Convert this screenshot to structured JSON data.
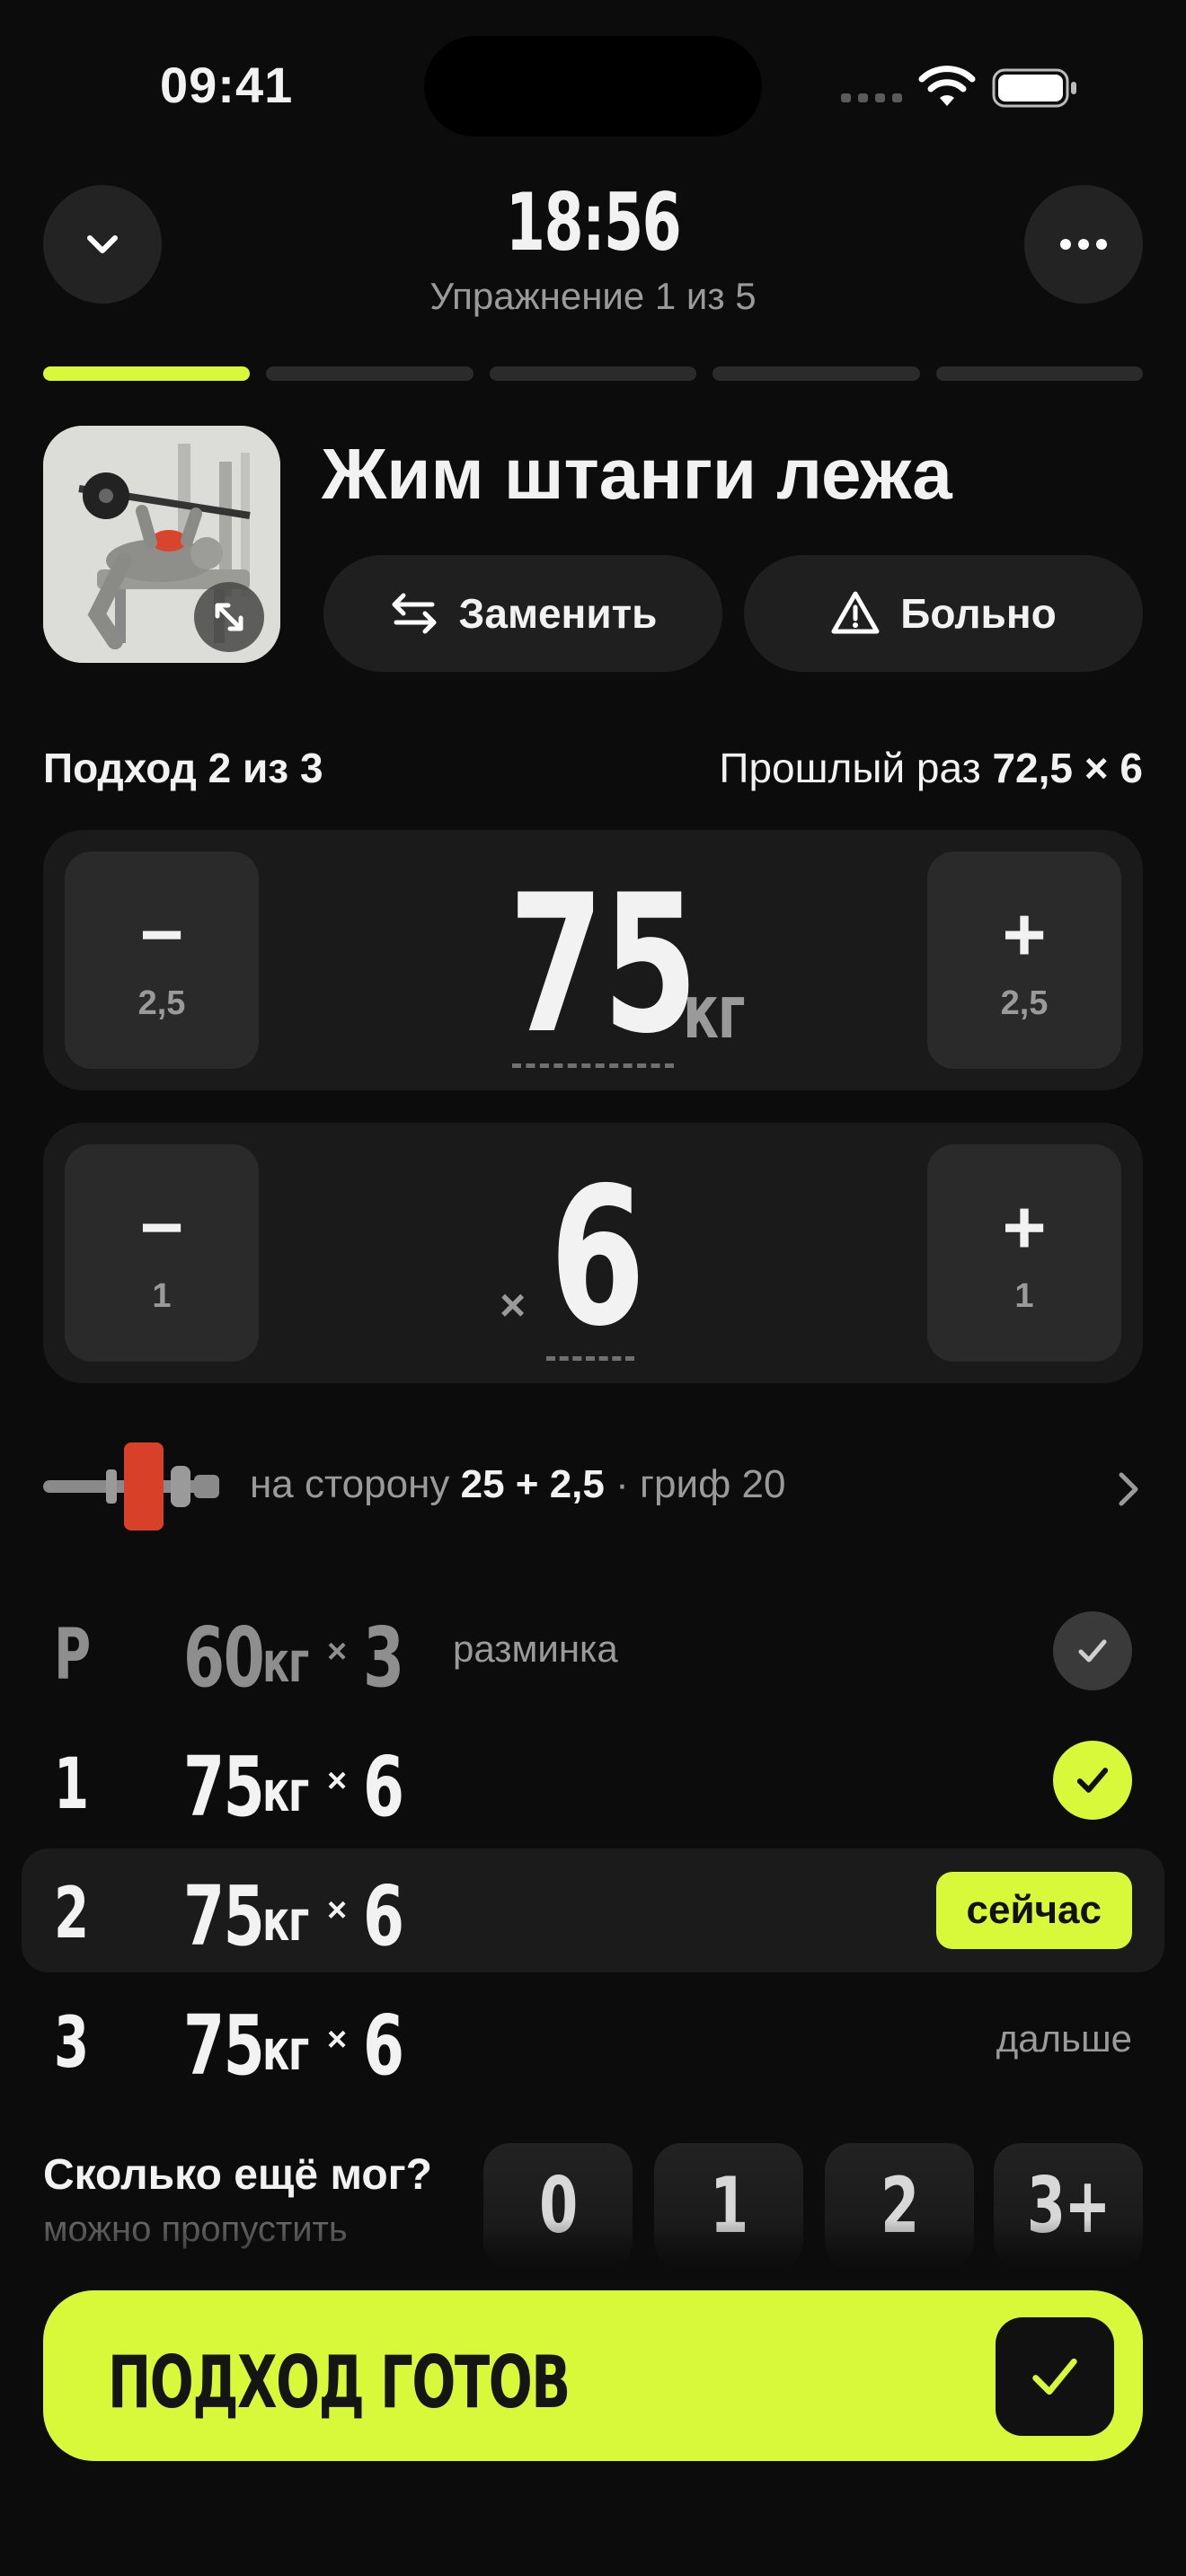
{
  "status_bar": {
    "time": "09:41"
  },
  "header": {
    "timer": "18:56",
    "exercise_count": "Упражнение 1 из 5",
    "progress": {
      "total": 5,
      "current": 1
    }
  },
  "exercise": {
    "title": "Жим штанги лежа",
    "replace_label": "Заменить",
    "hurts_label": "Больно"
  },
  "set_info": {
    "label": "Подход 2 из 3",
    "last_time_prefix": "Прошлый раз",
    "last_time_value": "72,5 × 6"
  },
  "weight": {
    "value": "75",
    "unit": "кг",
    "minus": "−",
    "plus": "+",
    "step": "2,5"
  },
  "reps": {
    "value": "6",
    "x": "×",
    "minus": "−",
    "plus": "+",
    "step": "1"
  },
  "plates": {
    "prefix": "на сторону",
    "per_side": "25 + 2,5",
    "bar": "· гриф 20"
  },
  "sets": [
    {
      "idx": "Р",
      "weight": "60",
      "unit": "кг",
      "x": "×",
      "reps": "3",
      "note": "разминка",
      "status": "done-warmup"
    },
    {
      "idx": "1",
      "weight": "75",
      "unit": "кг",
      "x": "×",
      "reps": "6",
      "note": "",
      "status": "done"
    },
    {
      "idx": "2",
      "weight": "75",
      "unit": "кг",
      "x": "×",
      "reps": "6",
      "note": "",
      "status": "current",
      "badge": "сейчас"
    },
    {
      "idx": "3",
      "weight": "75",
      "unit": "кг",
      "x": "×",
      "reps": "6",
      "note": "",
      "status": "next",
      "badge": "дальше"
    }
  ],
  "rir": {
    "question": "Сколько ещё мог?",
    "hint": "можно пропустить",
    "options": [
      "0",
      "1",
      "2",
      "3+"
    ]
  },
  "done": {
    "label": "ПОДХОД ГОТОВ"
  },
  "colors": {
    "accent": "#d8f83a",
    "background": "#0c0c0c",
    "surface": "#1a1a1a",
    "plate_red": "#d8402a"
  }
}
